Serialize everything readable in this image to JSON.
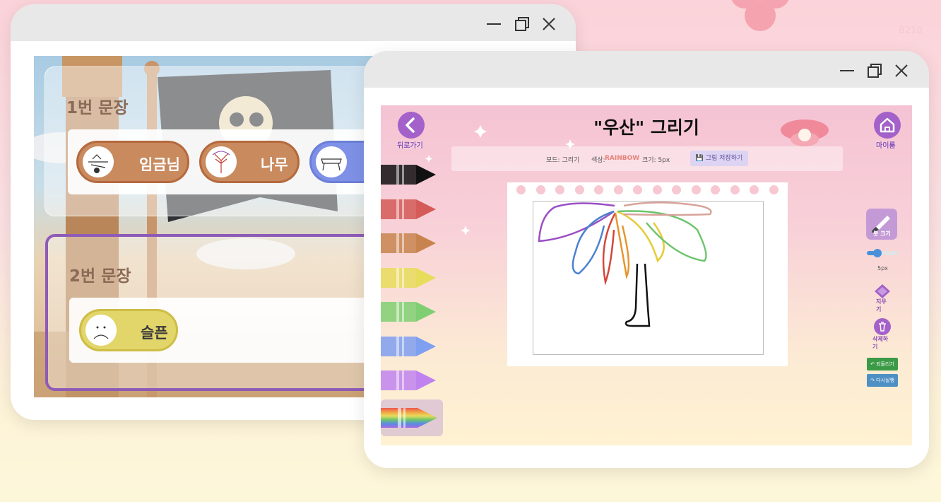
{
  "watermark": "B210",
  "back_window": {
    "sentence1": {
      "title": "1번 문장",
      "chips": [
        {
          "label": "임금님"
        },
        {
          "label": "나무"
        }
      ]
    },
    "sentence2": {
      "title": "2번 문장",
      "chips": [
        {
          "label": "슬픈"
        }
      ]
    }
  },
  "front_window": {
    "back_label": "뒤로가기",
    "home_label": "마이룸",
    "title": "\"우산\" 그리기",
    "info": {
      "mode_label": "모드: 그리기",
      "color_label": "색상:",
      "color_value": "RAINBOW",
      "size_label": "크기: 5px",
      "save_label": "그림 저장하기"
    },
    "crayon_colors": [
      "#111111",
      "#d45b58",
      "#c8844f",
      "#e8dc5c",
      "#7fcf72",
      "#7f9ff0",
      "#bf82ee"
    ],
    "rainbow_selected": true,
    "tools": {
      "brush_label": "붓 크기",
      "size_value": 5,
      "size_display": "5px",
      "eraser_label": "지우기",
      "clear_label": "삭제하기",
      "undo_label": "↶ 되돌리기",
      "redo_label": "↷ 다시실행"
    },
    "colors": {
      "accent": "#a361c9",
      "undo": "#3b9a46",
      "redo": "#4e8fc4"
    }
  }
}
